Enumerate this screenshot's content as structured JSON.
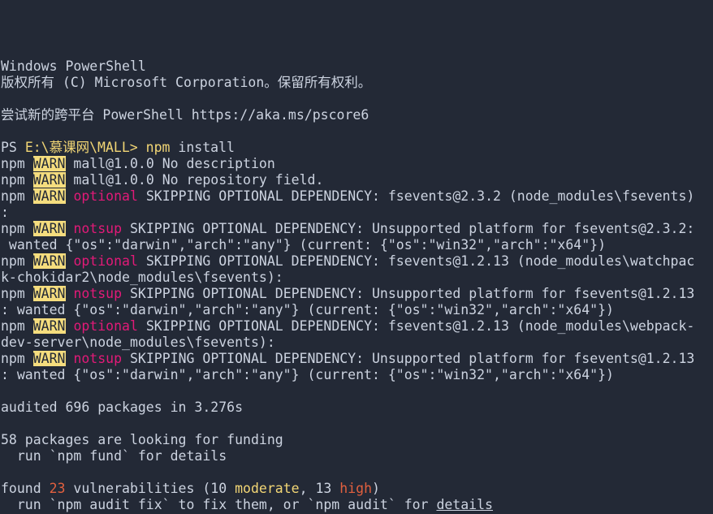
{
  "window": {
    "title": "Windows PowerShell",
    "background_color": "#232936",
    "foreground_color": "#ccd3e0",
    "accent_yellow": "#f2d675",
    "accent_magenta": "#e21a78",
    "accent_red": "#e2603f",
    "warn_badge_bg": "#f5dd7e",
    "warn_badge_fg": "#232936"
  },
  "banner": {
    "line1": "Windows PowerShell",
    "line2": "版权所有 (C) Microsoft Corporation。保留所有权利。",
    "line3_cn": "尝试新的跨平台",
    "line3_en": " PowerShell https://aka.ms/pscore6"
  },
  "prompt": {
    "ps_label": "PS ",
    "path": "E:\\慕课网\\MALL>",
    "space": " ",
    "command_name": "npm",
    "command_args": " install"
  },
  "labels": {
    "npm": "npm ",
    "warn": "WARN",
    "space": " ",
    "optional": "optional",
    "notsup": "notsup"
  },
  "log": {
    "warn1_text": " mall@1.0.0 No description",
    "warn2_text": " mall@1.0.0 No repository field.",
    "opt1_text": " SKIPPING OPTIONAL DEPENDENCY: fsevents@2.3.2 (node_modules\\fsevents)",
    "opt1_cont": ":",
    "notsup1_text": " SKIPPING OPTIONAL DEPENDENCY: Unsupported platform for fsevents@2.3.2:",
    "notsup1_cont": " wanted {\"os\":\"darwin\",\"arch\":\"any\"} (current: {\"os\":\"win32\",\"arch\":\"x64\"})",
    "opt2_text": " SKIPPING OPTIONAL DEPENDENCY: fsevents@1.2.13 (node_modules\\watchpac",
    "opt2_cont": "k-chokidar2\\node_modules\\fsevents):",
    "notsup2_text": " SKIPPING OPTIONAL DEPENDENCY: Unsupported platform for fsevents@1.2.13",
    "notsup2_cont": ": wanted {\"os\":\"darwin\",\"arch\":\"any\"} (current: {\"os\":\"win32\",\"arch\":\"x64\"})",
    "opt3_text": " SKIPPING OPTIONAL DEPENDENCY: fsevents@1.2.13 (node_modules\\webpack-",
    "opt3_cont": "dev-server\\node_modules\\fsevents):",
    "notsup3_text": " SKIPPING OPTIONAL DEPENDENCY: Unsupported platform for fsevents@1.2.13",
    "notsup3_cont": ": wanted {\"os\":\"darwin\",\"arch\":\"any\"} (current: {\"os\":\"win32\",\"arch\":\"x64\"})"
  },
  "summary": {
    "audited": "audited 696 packages in 3.276s",
    "funding_count": "58 packages are looking for funding",
    "funding_hint": "  run `npm fund` for details"
  },
  "vulnerabilities": {
    "found_prefix": "found ",
    "total": "23",
    "mid_text": " vulnerabilities (10 ",
    "moderate_label": "moderate",
    "sep": ", 13 ",
    "high_label": "high",
    "suffix": ")",
    "fix_prefix": "  run `npm audit fix` to fix them, or `npm audit` for ",
    "details_link": "details"
  }
}
